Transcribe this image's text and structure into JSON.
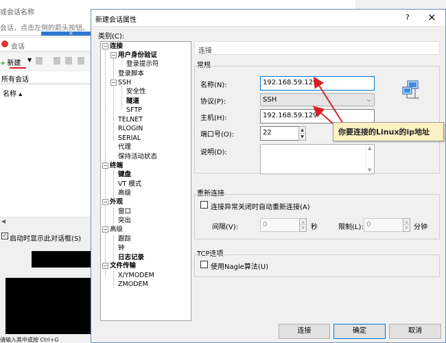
{
  "background": {
    "top_line1": "或会话名称",
    "top_line2": "会话，点击左侧的箭头按钮。",
    "tab_close": "×",
    "session_title": "会话",
    "new_label": "新建",
    "all_sessions": "所有会话",
    "col_name": "名称",
    "startup_checkbox": "启动时显示此对话框(S)",
    "status_text": "请输入其中或按 Ctrl+G"
  },
  "dialog": {
    "title": "新建会话属性",
    "help": "?",
    "close": "×",
    "category_label": "类别(C):",
    "tree": {
      "connection": "连接",
      "user_auth": "用户身份验证",
      "login_prompt": "登录提示符",
      "login_script": "登录脚本",
      "ssh": "SSH",
      "security": "安全性",
      "tunnel": "隧道",
      "sftp": "SFTP",
      "telnet": "TELNET",
      "rlogin": "RLOGIN",
      "serial": "SERIAL",
      "proxy": "代理",
      "keepalive": "保持活动状态",
      "terminal": "终端",
      "keyboard": "键盘",
      "vt_mode": "VT 模式",
      "advanced": "高级",
      "appearance": "外观",
      "window": "窗口",
      "highlight": "突出",
      "advanced2": "高级",
      "trace": "跟踪",
      "bell": "钟",
      "logging": "日志记录",
      "file_transfer": "文件传输",
      "xymodem": "X/YMODEM",
      "zmodem": "ZMODEM"
    },
    "panel_header": "连接",
    "general": {
      "group": "常规",
      "name_label": "名称(N):",
      "name_value": "192.168.59.129",
      "protocol_label": "协议(P):",
      "protocol_value": "SSH",
      "host_label": "主机(H):",
      "host_value": "192.168.59.129",
      "port_label": "端口号(O):",
      "port_value": "22",
      "desc_label": "说明(D):",
      "desc_value": ""
    },
    "reconnect": {
      "group": "重新连接",
      "checkbox_label": "连接异常关闭时自动重新连接(A)",
      "interval_label": "间隔(V):",
      "interval_value": "0",
      "sec_unit": "秒",
      "limit_label": "限制(L):",
      "limit_value": "0",
      "min_unit": "分钟"
    },
    "tcp": {
      "group": "TCP选项",
      "nagle_label": "使用Nagle算法(U)"
    },
    "callout": "你要连接的Linux的ip地址",
    "buttons": {
      "connect": "连接",
      "ok": "确定",
      "cancel": "取消"
    }
  },
  "colors": {
    "accent": "#0078d7",
    "callout_bg": "#fdf1c4",
    "arrow": "#d92020"
  }
}
